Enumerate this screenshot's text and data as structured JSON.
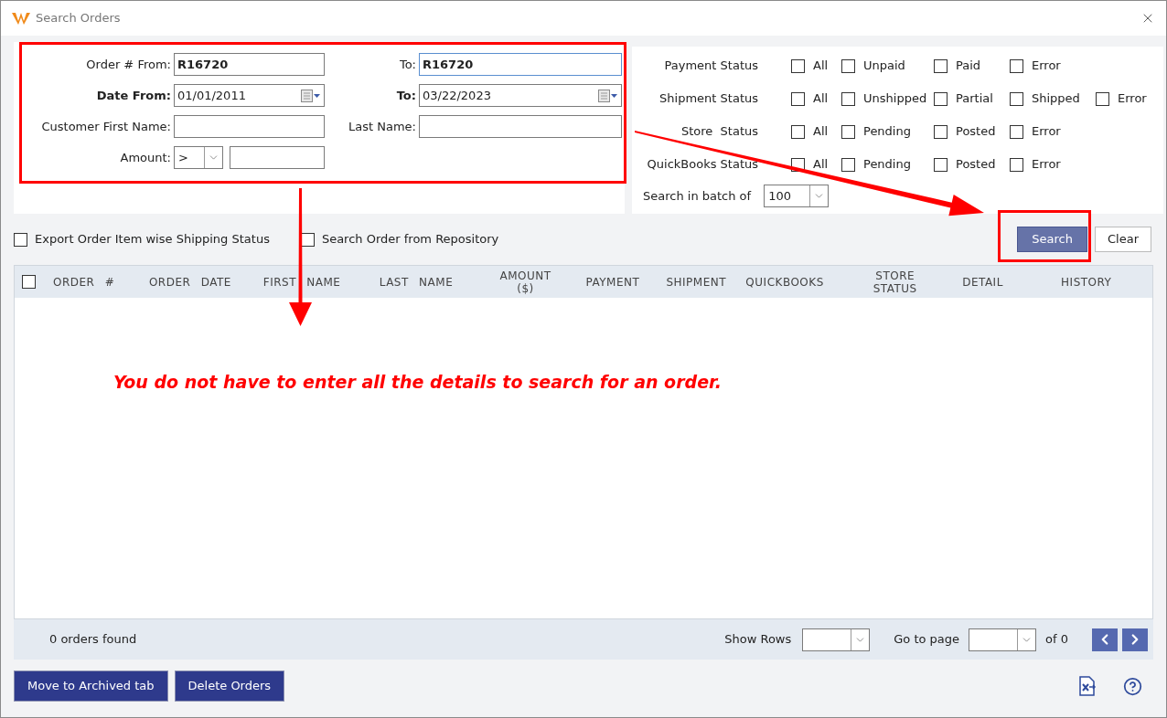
{
  "window": {
    "title": "Search Orders"
  },
  "order_filters": {
    "order_from": {
      "label": "Order # From:",
      "value": "R16720"
    },
    "order_to": {
      "label": "To:",
      "value": "R16720"
    },
    "date_from": {
      "label": "Date From:",
      "value": "01/01/2011"
    },
    "date_to": {
      "label": "To:",
      "value": "03/22/2023"
    },
    "first_name": {
      "label": "Customer First Name:"
    },
    "last_name": {
      "label": "Last Name:"
    },
    "amount": {
      "label": "Amount:",
      "operator": ">"
    }
  },
  "status_filters": [
    {
      "label": "Payment Status",
      "options": [
        {
          "label": "All",
          "checked": false
        },
        {
          "label": "Unpaid",
          "checked": false
        },
        {
          "label": "Paid",
          "checked": false
        },
        {
          "label": "Error",
          "checked": false
        }
      ]
    },
    {
      "label": "Shipment Status",
      "options": [
        {
          "label": "All",
          "checked": false
        },
        {
          "label": "Unshipped",
          "checked": false
        },
        {
          "label": "Partial",
          "checked": false
        },
        {
          "label": "Shipped",
          "checked": false
        },
        {
          "label": "Error",
          "checked": false
        }
      ]
    },
    {
      "label": "Store  Status",
      "options": [
        {
          "label": "All",
          "checked": false
        },
        {
          "label": "Pending",
          "checked": false
        },
        {
          "label": "Posted",
          "checked": false
        },
        {
          "label": "Error",
          "checked": false
        }
      ]
    },
    {
      "label": "QuickBooks Status",
      "options": [
        {
          "label": "All",
          "checked": false
        },
        {
          "label": "Pending",
          "checked": false
        },
        {
          "label": "Posted",
          "checked": false
        },
        {
          "label": "Error",
          "checked": false
        }
      ]
    }
  ],
  "batch": {
    "label": "Search in batch of",
    "value": "100"
  },
  "options": [
    {
      "label": "Export Order Item wise Shipping Status",
      "checked": false
    },
    {
      "label": "Search Order from Repository",
      "checked": false
    }
  ],
  "search_button": "Search",
  "clear_button": "Clear",
  "table": {
    "select_all_checked": false,
    "columns": [
      "ORDER #",
      "ORDER DATE",
      "FIRST NAME",
      "LAST NAME",
      "AMOUNT ($)",
      "PAYMENT",
      "SHIPMENT",
      "QUICKBOOKS",
      "STORE STATUS",
      "DETAIL",
      "HISTORY"
    ]
  },
  "annotation": "You do not have to enter all the details to search for an order.",
  "footer": {
    "count": "0 orders found",
    "show_rows": "Show Rows",
    "go_to_page": "Go to page",
    "of_total": "of 0"
  },
  "bottom_buttons": [
    "Move to Archived tab",
    "Delete Orders"
  ]
}
